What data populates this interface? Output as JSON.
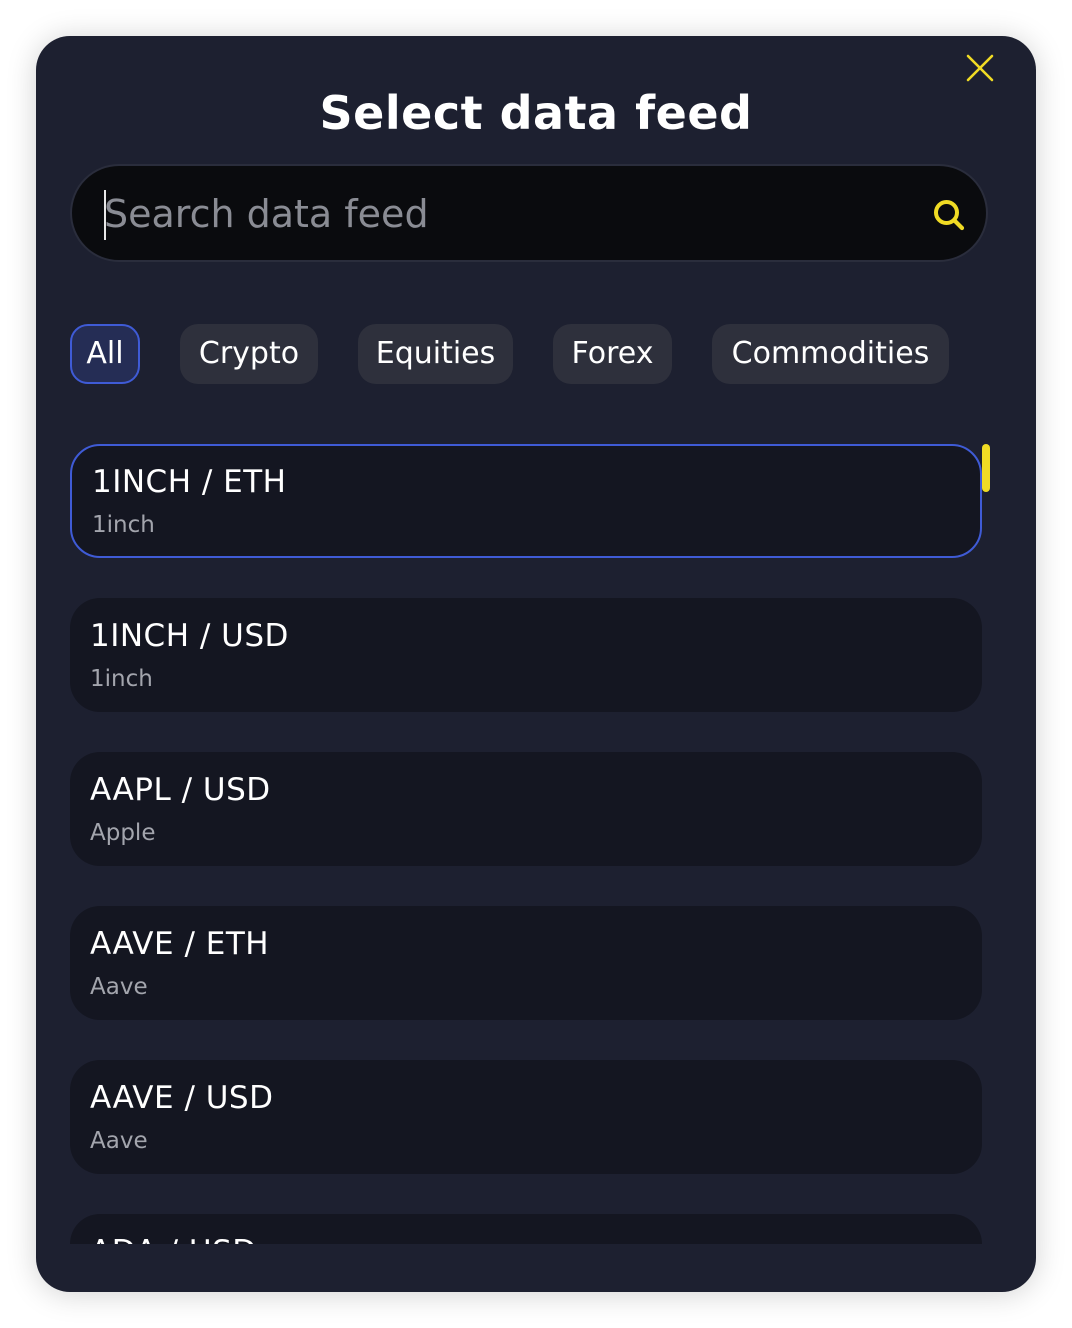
{
  "modal": {
    "title": "Select data feed"
  },
  "search": {
    "placeholder": "Search data feed",
    "value": ""
  },
  "tabs": [
    {
      "label": "All",
      "active": true
    },
    {
      "label": "Crypto",
      "active": false
    },
    {
      "label": "Equities",
      "active": false
    },
    {
      "label": "Forex",
      "active": false
    },
    {
      "label": "Commodities",
      "active": false
    }
  ],
  "feeds": [
    {
      "pair": "1INCH / ETH",
      "name": "1inch",
      "selected": true
    },
    {
      "pair": "1INCH / USD",
      "name": "1inch",
      "selected": false
    },
    {
      "pair": "AAPL / USD",
      "name": "Apple",
      "selected": false
    },
    {
      "pair": "AAVE / ETH",
      "name": "Aave",
      "selected": false
    },
    {
      "pair": "AAVE / USD",
      "name": "Aave",
      "selected": false
    },
    {
      "pair": "ADA / USD",
      "name": "",
      "selected": false
    }
  ],
  "colors": {
    "accent": "#f0db24",
    "selection_border": "#3f5bd6",
    "modal_bg": "#1d2030",
    "item_bg": "#141621"
  },
  "icons": {
    "close": "close-icon",
    "search": "search-icon"
  }
}
